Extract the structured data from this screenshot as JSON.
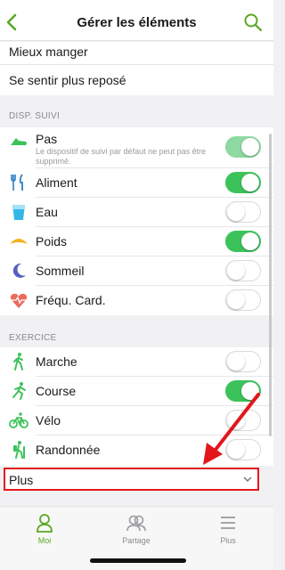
{
  "header": {
    "title": "Gérer les éléments",
    "back_icon": "chevron-left-icon",
    "search_icon": "search-icon",
    "accent_color": "#5aa821"
  },
  "top_rows": [
    {
      "label": "Mieux manger"
    },
    {
      "label": "Se sentir plus reposé"
    }
  ],
  "tracking_section": {
    "title": "DISP. SUIVI",
    "items": [
      {
        "label": "Pas",
        "subtitle": "Le dispositif de suivi par défaut ne peut pas être supprimé.",
        "icon": "shoe-icon",
        "toggle": "on-disabled"
      },
      {
        "label": "Aliment",
        "icon": "fork-knife-icon",
        "toggle": "on"
      },
      {
        "label": "Eau",
        "icon": "water-glass-icon",
        "toggle": "off"
      },
      {
        "label": "Poids",
        "icon": "scale-icon",
        "toggle": "on"
      },
      {
        "label": "Sommeil",
        "icon": "moon-icon",
        "toggle": "off"
      },
      {
        "label": "Fréqu. Card.",
        "icon": "heart-rate-icon",
        "toggle": "off"
      }
    ]
  },
  "exercise_section": {
    "title": "EXERCICE",
    "items": [
      {
        "label": "Marche",
        "icon": "walking-icon",
        "toggle": "off"
      },
      {
        "label": "Course",
        "icon": "running-icon",
        "toggle": "on"
      },
      {
        "label": "Vélo",
        "icon": "bicycle-icon",
        "toggle": "off"
      },
      {
        "label": "Randonnée",
        "icon": "hiking-icon",
        "toggle": "off"
      }
    ]
  },
  "more_row": {
    "label": "Plus",
    "chevron_icon": "chevron-down-icon",
    "highlight_color": "#e3161b"
  },
  "tabbar": {
    "tabs": [
      {
        "label": "Moi",
        "icon": "person-icon",
        "active": true
      },
      {
        "label": "Partage",
        "icon": "people-icon",
        "active": false
      },
      {
        "label": "Plus",
        "icon": "menu-icon",
        "active": false
      }
    ]
  }
}
